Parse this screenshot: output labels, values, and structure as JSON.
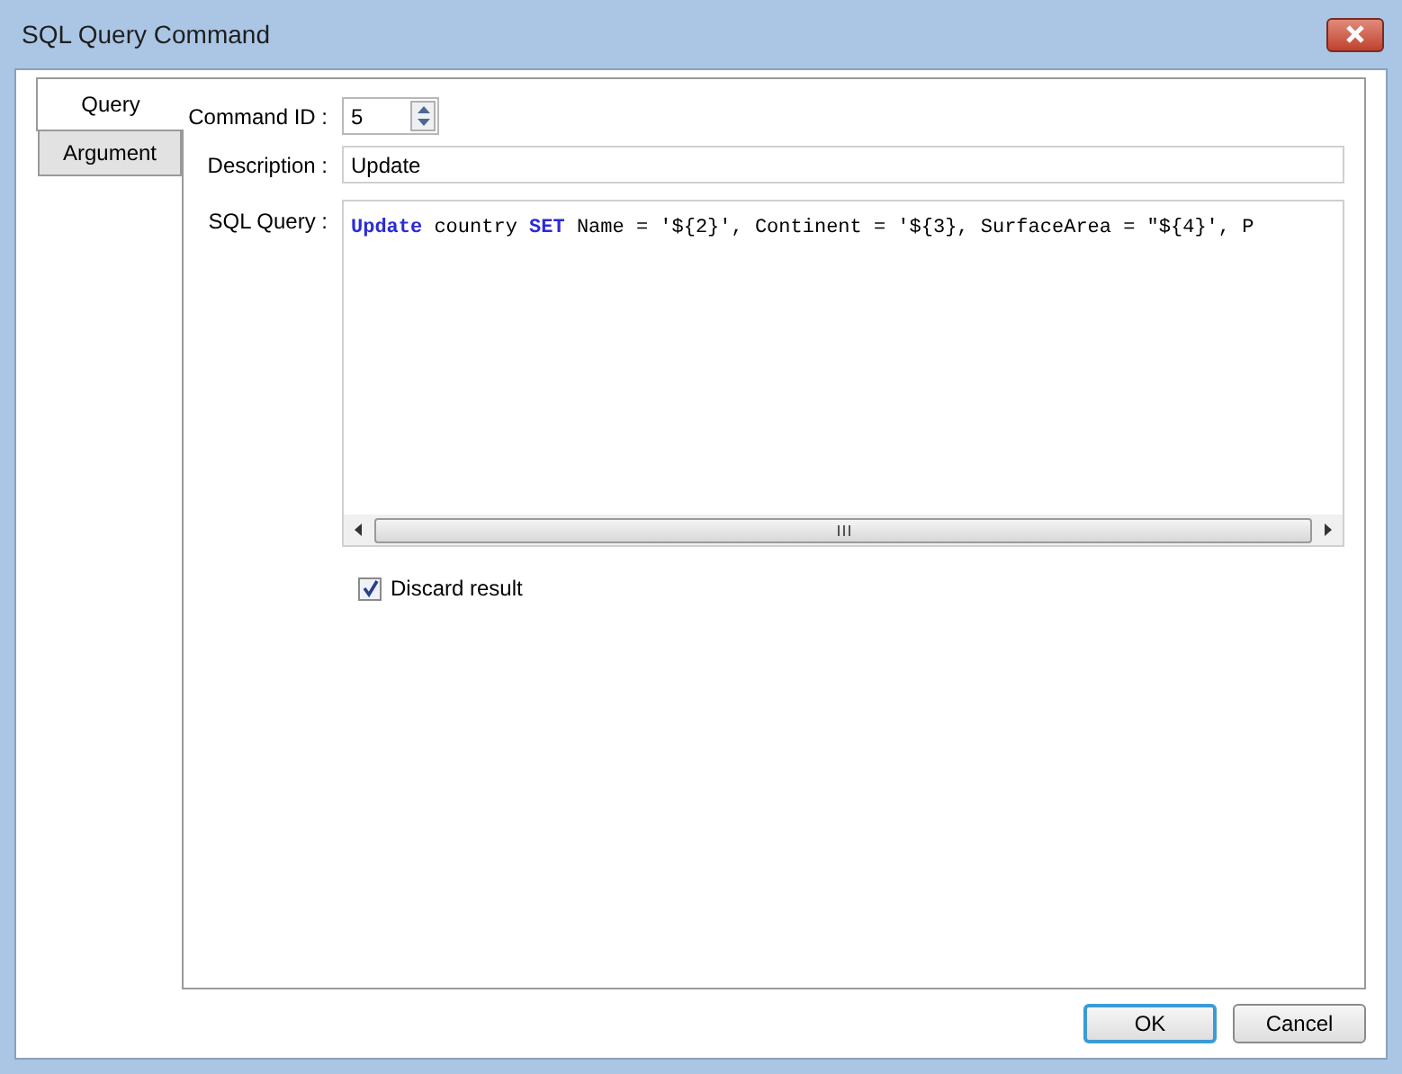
{
  "window": {
    "title": "SQL Query Command"
  },
  "tabs": [
    {
      "label": "Query",
      "selected": true
    },
    {
      "label": "Argument",
      "selected": false
    }
  ],
  "form": {
    "command_id": {
      "label": "Command ID :",
      "value": "5"
    },
    "description": {
      "label": "Description :",
      "value": "Update"
    },
    "sql_query": {
      "label": "SQL Query :",
      "tokens": [
        {
          "kind": "keyword",
          "text": "Update"
        },
        {
          "kind": "plain",
          "text": " country "
        },
        {
          "kind": "keyword",
          "text": "SET"
        },
        {
          "kind": "plain",
          "text": " Name = '${2}', Continent = '${3}, SurfaceArea = \"${4}', P"
        }
      ]
    },
    "discard_result": {
      "label": "Discard result",
      "checked": true
    }
  },
  "buttons": [
    {
      "label": "OK",
      "default": true
    },
    {
      "label": "Cancel",
      "default": false
    }
  ]
}
